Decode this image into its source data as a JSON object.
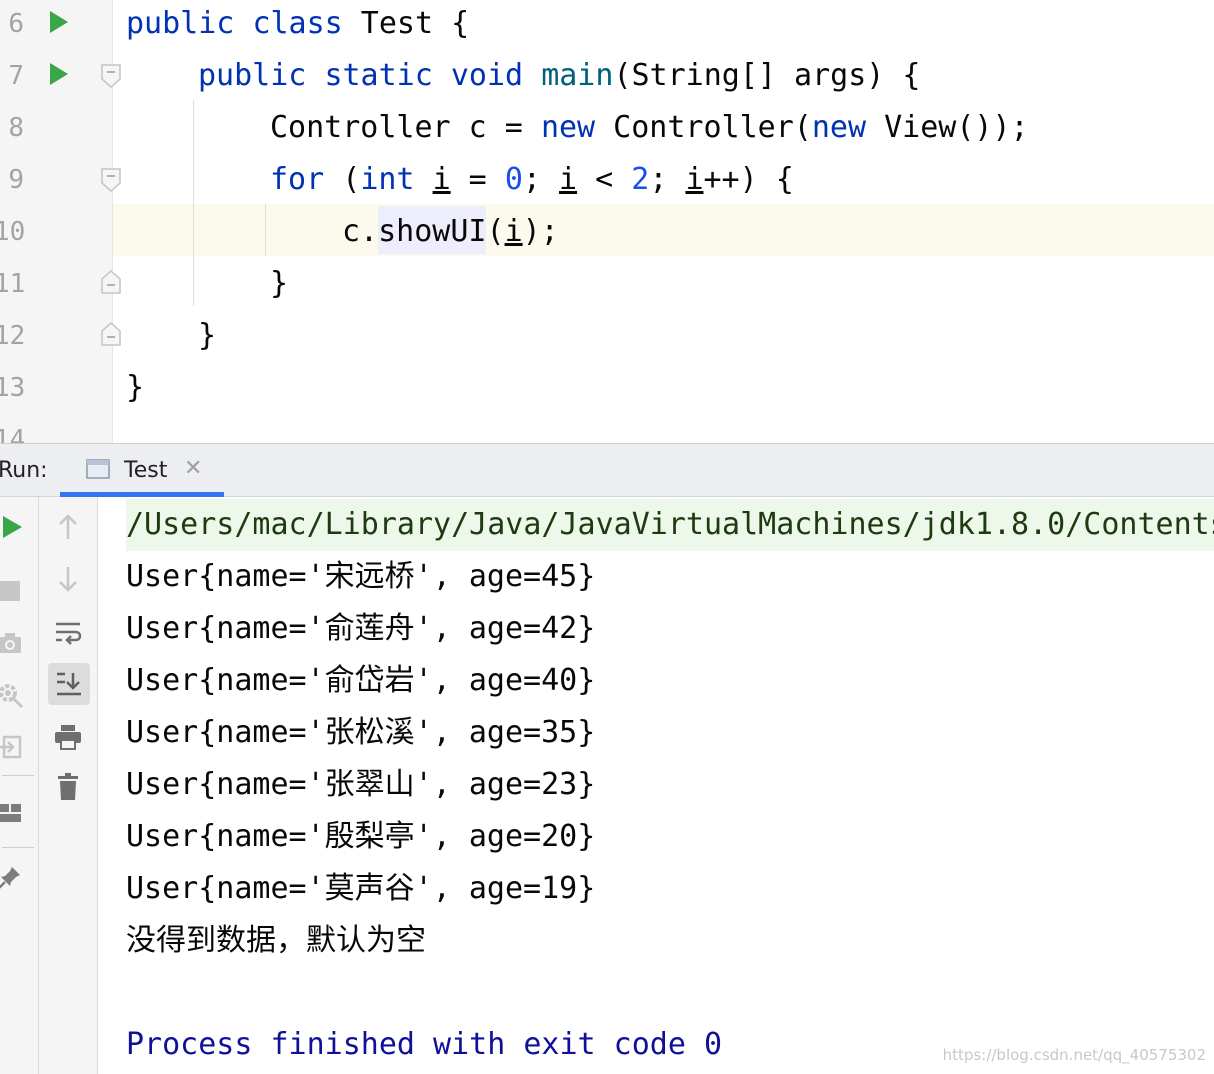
{
  "editor": {
    "line_numbers": [
      "6",
      "7",
      "8",
      "9",
      "10",
      "11",
      "12",
      "13",
      "14"
    ],
    "code": {
      "line6": {
        "t1": "public",
        "t2": " ",
        "t3": "class",
        "t4": " Test {"
      },
      "line7": {
        "t1": "public",
        "t2": " ",
        "t3": "static",
        "t4": " ",
        "t5": "void",
        "t6": " ",
        "t7": "main",
        "t8": "(String[] args) {"
      },
      "line8": {
        "t1": "Controller c = ",
        "t2": "new",
        "t3": " Controller(",
        "t4": "new",
        "t5": " View());"
      },
      "line9": {
        "t1": "for",
        "t2": " (",
        "t3": "int",
        "t4": " ",
        "t5": "i",
        "t6": " = ",
        "t7": "0",
        "t8": "; ",
        "t9": "i",
        "t10": " < ",
        "t11": "2",
        "t12": "; ",
        "t13": "i",
        "t14": "++) {"
      },
      "line10": {
        "t1": "c.",
        "t2": "showUI",
        "t3": "(",
        "t4": "i",
        "t5": ");"
      },
      "line11": {
        "t1": "}"
      },
      "line12": {
        "t1": "}"
      },
      "line13": {
        "t1": "}"
      }
    },
    "colors": {
      "keyword": "#0033b3",
      "number": "#1750eb",
      "current_line": "#fcfaed",
      "run_icon": "#3aa648"
    }
  },
  "run_window": {
    "label": "Run:",
    "tab_title": "Test",
    "tab_close": "✕",
    "left_toolbar_icons": [
      "rerun-icon",
      "stop-icon",
      "camera-icon",
      "settings-icon",
      "login-icon",
      "layout-icon",
      "pin-icon"
    ],
    "right_toolbar_icons": [
      "arrow-up-icon",
      "arrow-down-icon",
      "soft-wrap-icon",
      "scroll-to-end-icon",
      "print-icon",
      "trash-icon"
    ],
    "console": {
      "command": "/Users/mac/Library/Java/JavaVirtualMachines/jdk1.8.0/Contents",
      "lines": [
        "User{name='宋远桥', age=45}",
        "User{name='俞莲舟', age=42}",
        "User{name='俞岱岩', age=40}",
        "User{name='张松溪', age=35}",
        "User{name='张翠山', age=23}",
        "User{name='殷梨亭', age=20}",
        "User{name='莫声谷', age=19}",
        "没得到数据，默认为空"
      ],
      "process": "Process finished with exit code 0"
    }
  },
  "watermark": "https://blog.csdn.net/qq_40575302"
}
